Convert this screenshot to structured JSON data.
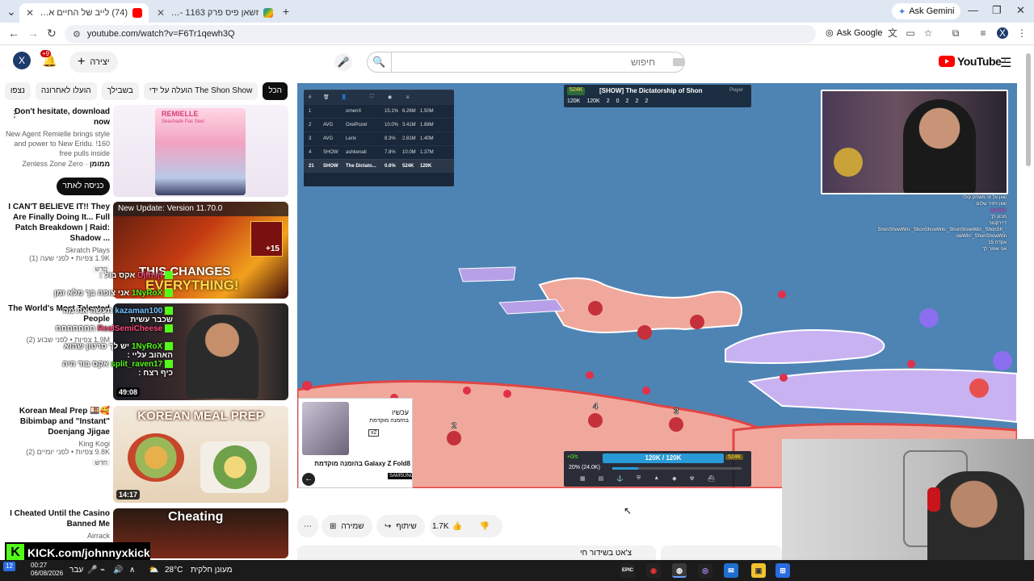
{
  "browser": {
    "tabs": [
      {
        "title": "(74) לייב של החיים אל תוך הל'",
        "active": true
      },
      {
        "title": "זשאן פיס פרק 1163 - חיפוש ב-ג",
        "active": false
      }
    ],
    "gemini_label": "Ask Gemini",
    "url": "youtube.com/watch?v=F6Tr1qewh3Q",
    "ask_google_label": "Ask Google",
    "profile_letter": "X"
  },
  "youtube": {
    "logo_text": "YouTube",
    "logo_region": "IL",
    "search_placeholder": "חיפוש",
    "create_label": "יצירה",
    "notifications_badge": "+9",
    "avatar_letter": "X"
  },
  "chips": [
    "הכל",
    "The Shon Show הועלה על ידי",
    "בשבילך",
    "הועלו לאחרונה",
    "נצפו"
  ],
  "sidebar": {
    "ad": {
      "title": "Don't hesitate, download now",
      "description": "New Agent Remielle brings style and power to New Eridu. !160 free pulls inside",
      "sponsor": "Zenless Zone Zero",
      "sponsored": "ממומן",
      "cta": "כניסה לאתר",
      "thumb_brand": "REMIELLE",
      "thumb_sub": "Seashade Pas Seul"
    },
    "videos": [
      {
        "title": "I CAN'T BELIEVE IT!! They Are Finally Doing It... Full Patch Breakdown | Raid: Shadow ...",
        "channel": "Skratch Plays",
        "stats": "1.9K ‏צפיות • לפני שעה (1)",
        "badge": "חדש",
        "thumb_top": "New Update: Version 11.70.0",
        "thumb_main": "THIS CHANGES",
        "thumb_main2": "EVERYTHING!",
        "thumb_badge": "+15",
        "duration": ""
      },
      {
        "title": "The World's Most Talented People",
        "channel": "",
        "stats": "1.9M ‏צפיות • לפני שבוע (2)",
        "badge": "",
        "duration": "49:08"
      },
      {
        "title": "Korean Meal Prep 🍱🥰 Bibimbap and \"Instant\" Doenjang Jjigae",
        "channel": "King Kogi",
        "stats": "9.8K ‏צפיות • לפני יומיים (2)",
        "badge": "חדש",
        "thumb_main": "KOREAN MEAL PREP",
        "duration": "14:17"
      },
      {
        "title": "I Cheated Until the Casino Banned Me",
        "channel": "Airrack",
        "stats": "",
        "badge": "",
        "thumb_main": "Cheating"
      }
    ]
  },
  "kick_overlay": [
    {
      "user": "Djfhsjf",
      "msg": "אקס בול :"
    },
    {
      "user": "1NyRoX",
      "msg": "אני צופה בך מלא זמן"
    },
    {
      "user": "kazaman100",
      "msg": "תעשה את מה שכבר עשית"
    },
    {
      "user": "RealSemiCheese",
      "msg": "חחחחחחח"
    },
    {
      "user": "1NyRoX",
      "msg": "יש לך סרטון שהוא האהוב עליי :"
    },
    {
      "user": "split_raven17",
      "msg": "אקס בוד היה כיף רצח :"
    }
  ],
  "game": {
    "leaderboard_headers": [
      "#",
      "",
      "",
      "",
      "",
      ""
    ],
    "leaderboard": [
      {
        "rank": "1",
        "tag": "",
        "name": "ornenX",
        "pct": "15.1%",
        "gold": "6.26M",
        "troops": "1.50M"
      },
      {
        "rank": "2",
        "tag": "AVG",
        "name": "OrelPozel",
        "pct": "10.0%",
        "gold": "3.41M",
        "troops": "1.88M"
      },
      {
        "rank": "3",
        "tag": "AVG",
        "name": "Lerix",
        "pct": "8.3%",
        "gold": "2.81M",
        "troops": "1.40M"
      },
      {
        "rank": "4",
        "tag": "SHOW",
        "name": "ashkenati",
        "pct": "7.8%",
        "gold": "10.0M",
        "troops": "1.37M"
      },
      {
        "rank": "21",
        "tag": "SHOW",
        "name": "The Dictato...",
        "pct": "0.6%",
        "gold": "524K",
        "troops": "120K"
      }
    ],
    "title_gold": "524K",
    "title_text": "[SHOW] The Dictatorship of Shon",
    "title_role": "Player",
    "title_stats": [
      "120K",
      "120K",
      "2",
      "0",
      "2",
      "2",
      "2"
    ],
    "bottom_rate": "+0/s",
    "bottom_troops": "120K / 120K",
    "bottom_gold": "524K",
    "bottom_ratio": "20% (24.0K)",
    "ship_numbers": [
      "2",
      "4",
      "3"
    ],
    "chat_lines": [
      {
        "u": "",
        "m": "שוון על זה משחק קולר"
      },
      {
        "u": "",
        "m": "שוון יחזיר שלום"
      },
      {
        "u": "ayalajin",
        "m": ""
      },
      {
        "u": "",
        "m": "מכוון לך"
      },
      {
        "u": "",
        "m": "דיירקטור"
      },
      {
        "u": "",
        "m": ":_ShonShowWin:_ShonShowWin:_ShonShowWin:_ShonShowWin:_ShonShowWin:"
      },
      {
        "u": "",
        "m": "אקדח 15"
      },
      {
        "u": "",
        "m": "אני אומר לך"
      }
    ],
    "ad_card": {
      "line1": "עכשיו",
      "line2": "בהזמנה מוקדמת",
      "product": "Galaxy Z Fold8 בהזמנה מוקדמת",
      "brand": "SAMSUNG",
      "badge": "x2"
    }
  },
  "actions": {
    "likes": "1.7K",
    "share": "שיתוף",
    "save": "שמירה"
  },
  "description_text": "צ'אט בשידור חי",
  "kick_banner": "KICK.com/johnnyxkick",
  "taskbar": {
    "time": "00:27",
    "date": "06/08/2026",
    "lang": "עבר",
    "temp": "28°C",
    "weather": "מעונן חלקית",
    "notif": "12"
  },
  "colors": {
    "yt_red": "#ff0000",
    "ocean": "#4d84b4",
    "land": "#f0a89c",
    "kick_green": "#53fc18"
  }
}
